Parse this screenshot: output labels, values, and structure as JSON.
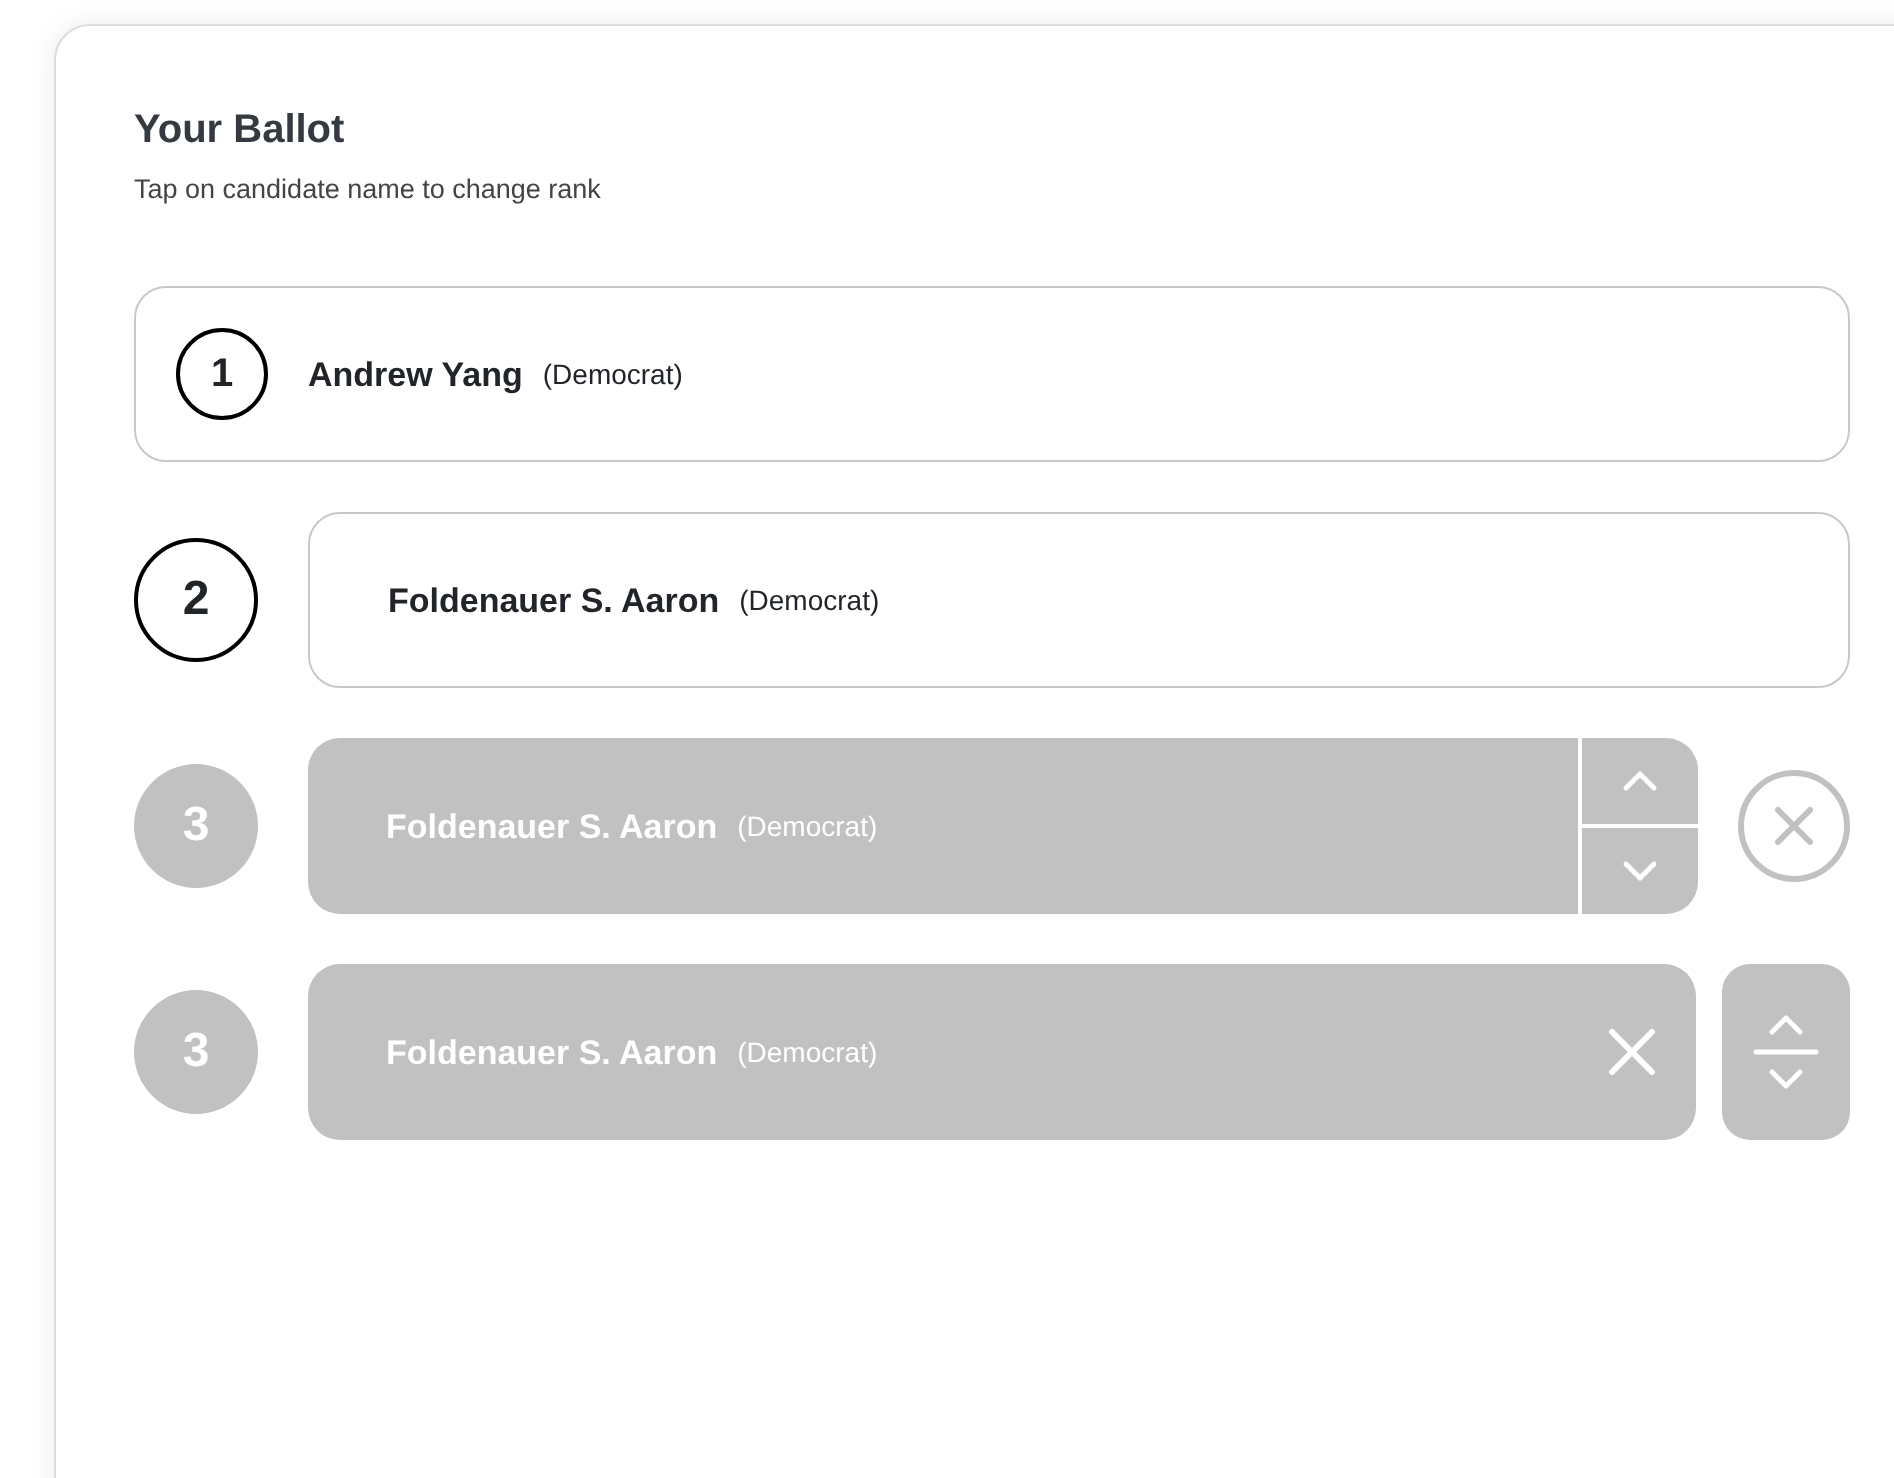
{
  "title": "Your Ballot",
  "subtitle": "Tap on candidate name to change rank",
  "rows": [
    {
      "kind": "inline",
      "rank": "1",
      "name": "Andrew Yang",
      "party": "(Democrat)"
    },
    {
      "kind": "outlined",
      "rank": "2",
      "name": "Foldenauer S. Aaron",
      "party": "(Democrat)"
    },
    {
      "kind": "split-arrows",
      "rank": "3",
      "name": "Foldenauer S. Aaron",
      "party": "(Democrat)"
    },
    {
      "kind": "side-stepper",
      "rank": "3",
      "name": "Foldenauer S. Aaron",
      "party": "(Democrat)"
    }
  ]
}
